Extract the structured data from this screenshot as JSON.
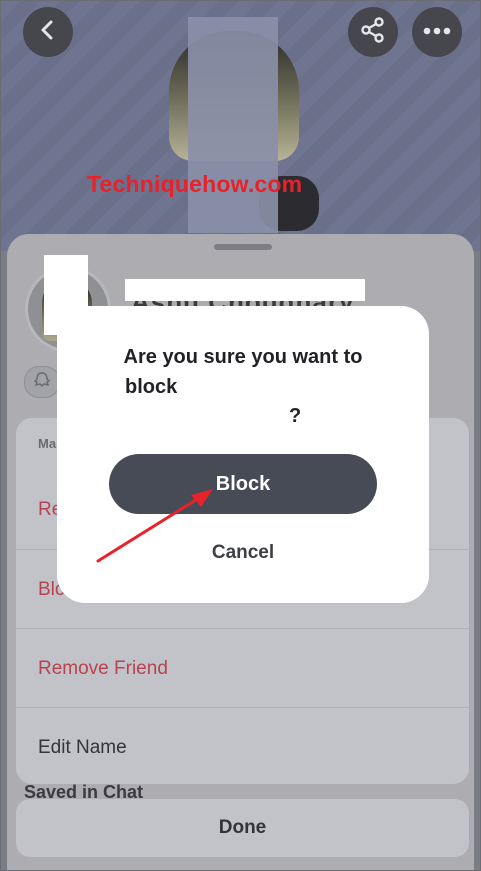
{
  "header": {
    "back_icon": "chevron-left-icon",
    "share_icon": "share-icon",
    "more_icon": "more-dots-icon"
  },
  "watermark": "Techniquehow.com",
  "profile": {
    "display_name_partial": "Ashu Choudhary",
    "friend_badge_icon": "ghost-icon"
  },
  "menu": {
    "section_label": "Ma",
    "items": [
      {
        "label": "Re",
        "color": "#b8424f"
      },
      {
        "label": "Blo",
        "color": "#b8424f"
      },
      {
        "label": "Remove Friend",
        "color": "#b8424f"
      },
      {
        "label": "Edit Name",
        "color": "#33353a"
      }
    ]
  },
  "saved_in_chat": "Saved in Chat",
  "done_label": "Done",
  "dialog": {
    "line1": "Are you sure you want to",
    "line2": "block",
    "line3": "?",
    "block_label": "Block",
    "cancel_label": "Cancel"
  },
  "colors": {
    "annotation_arrow": "#e8222a",
    "block_button": "#474b55",
    "destructive_text": "#b8424f"
  }
}
